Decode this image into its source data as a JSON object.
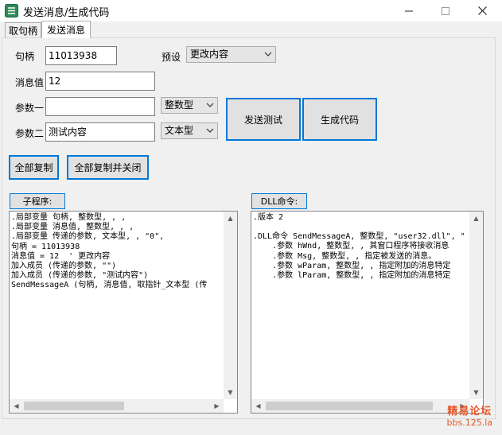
{
  "window": {
    "title": "发送消息/生成代码"
  },
  "tabs": [
    {
      "label": "取句柄"
    },
    {
      "label": "发送消息"
    }
  ],
  "form": {
    "handle_label": "句柄",
    "handle_value": "11013938",
    "preset_label": "预设",
    "preset_value": "更改内容",
    "msg_label": "消息值",
    "msg_value": "12",
    "param1_label": "参数一",
    "param1_value": "",
    "param1_type": "整数型",
    "param2_label": "参数二",
    "param2_value": "测试内容",
    "param2_type": "文本型"
  },
  "buttons": {
    "send_test": "发送测试",
    "gen_code": "生成代码",
    "copy_all": "全部复制",
    "copy_all_close": "全部复制并关闭"
  },
  "sub": {
    "header": "子程序:",
    "lines": [
      ".局部变量 句柄, 整数型, , ,",
      ".局部变量 消息值, 整数型, , ,",
      ".局部变量 传递的参数, 文本型, , \"0\",",
      "句柄 = 11013938",
      "消息值 = 12  ' 更改内容",
      "加入成员 (传递的参数, \"\")",
      "加入成员 (传递的参数, \"测试内容\")",
      "SendMessageA (句柄, 消息值, 取指针_文本型 (传"
    ]
  },
  "dll": {
    "header": "DLL命令:",
    "lines": [
      ".版本 2",
      "",
      ".DLL命令 SendMessageA, 整数型, \"user32.dll\", \"",
      "    .参数 hWnd, 整数型, , 其窗口程序将接收消息",
      "    .参数 Msg, 整数型, , 指定被发送的消息。",
      "    .参数 wParam, 整数型, , 指定附加的消息特定",
      "    .参数 lParam, 整数型, , 指定附加的消息特定"
    ]
  },
  "watermark": {
    "line1": "精易论坛",
    "line2": "bbs.125.la"
  }
}
